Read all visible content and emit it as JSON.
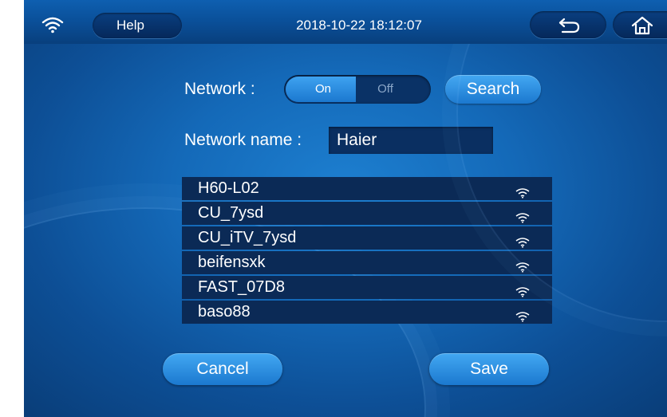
{
  "header": {
    "help_label": "Help",
    "datetime": "2018-10-22 18:12:07"
  },
  "icons": {
    "status": "wifi-icon",
    "back": "back-arrow-icon",
    "home": "home-icon",
    "signal": "wifi-signal-icon"
  },
  "network": {
    "label": "Network :",
    "on_label": "On",
    "off_label": "Off",
    "selected": "On",
    "search_label": "Search"
  },
  "network_name": {
    "label": "Network name :",
    "value": "Haier"
  },
  "networks": [
    {
      "ssid": "H60-L02"
    },
    {
      "ssid": "CU_7ysd"
    },
    {
      "ssid": "CU_iTV_7ysd"
    },
    {
      "ssid": "beifensxk"
    },
    {
      "ssid": "FAST_07D8"
    },
    {
      "ssid": "baso88"
    }
  ],
  "actions": {
    "cancel_label": "Cancel",
    "save_label": "Save"
  },
  "colors": {
    "background": "#1469b8",
    "accent": "#1b78cf",
    "field": "#0b2a56"
  }
}
